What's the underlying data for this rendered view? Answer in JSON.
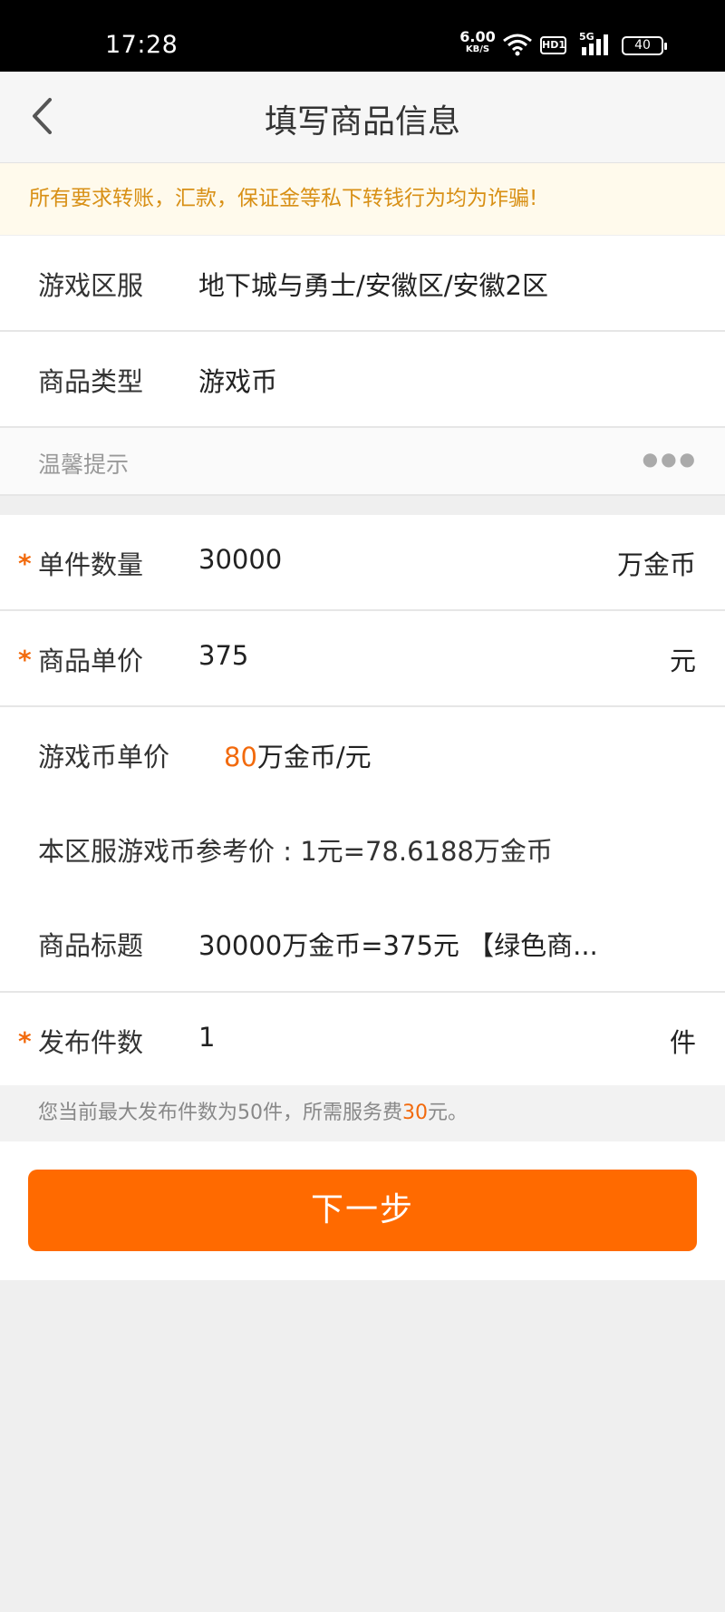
{
  "status_bar": {
    "time": "17:28",
    "net_speed": "6.00",
    "net_speed_unit": "KB/S",
    "hd_badge": "HD1",
    "network_type": "5G",
    "battery": "40"
  },
  "header": {
    "back_icon": "chevron-left-icon",
    "title": "填写商品信息"
  },
  "notice": {
    "text": "所有要求转账，汇款，保证金等私下转钱行为均为诈骗!",
    "color": "#d89016"
  },
  "fields": {
    "server": {
      "label": "游戏区服",
      "value": "地下城与勇士/安徽区/安徽2区"
    },
    "type": {
      "label": "商品类型",
      "value": "游戏币"
    },
    "tip": {
      "label": "温馨提示",
      "more_icon": "more-dots-icon"
    },
    "quantity": {
      "required": "*",
      "label": "单件数量",
      "value": "30000",
      "unit": "万金币"
    },
    "price": {
      "required": "*",
      "label": "商品单价",
      "value": "375",
      "unit": "元"
    },
    "coin_unit_price": {
      "label": "游戏币单价",
      "value_highlight": "80",
      "value_suffix": "万金币/元"
    },
    "reference_price": {
      "text": "本区服游戏币参考价 : 1元=78.6188万金币"
    },
    "title": {
      "label": "商品标题",
      "value": "30000万金币=375元 【绿色商..."
    },
    "publish_count": {
      "required": "*",
      "label": "发布件数",
      "value": "1",
      "unit": "件"
    }
  },
  "footer_note": {
    "prefix": "您当前最大发布件数为50件，所需服务费",
    "fee": "30",
    "suffix": "元。"
  },
  "next_button": {
    "label": "下一步"
  },
  "colors": {
    "accent": "#ff6a00",
    "highlight": "#f26a0d",
    "page_bg": "#efefef"
  }
}
